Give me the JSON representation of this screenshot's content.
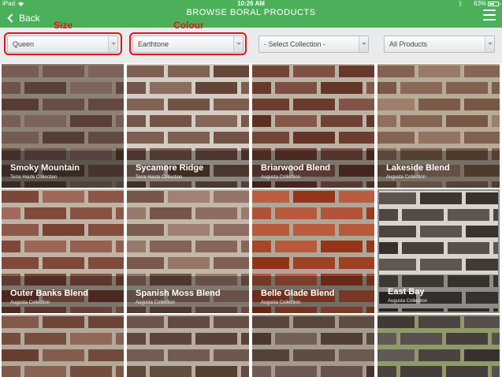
{
  "status_bar": {
    "carrier": "iPad",
    "time": "10:26 AM",
    "battery_percent": "63%",
    "battery_level": 0.63
  },
  "nav": {
    "back_label": "Back",
    "title": "BROWSE BORAL PRODUCTS"
  },
  "filters": {
    "size": "Queen",
    "colour": "Earthtone",
    "collection": "- Select Collection -",
    "products": "All Products"
  },
  "annotations": {
    "size": "Size",
    "colour": "Colour"
  },
  "products": [
    {
      "name": "Smoky Mountain",
      "collection": "Terre Haute Collection",
      "brick": "#6b5248",
      "mortar": "#8d8174"
    },
    {
      "name": "Sycamore Ridge",
      "collection": "Terre Haute Collection",
      "brick": "#7a5a4c",
      "mortar": "#d3cdc3"
    },
    {
      "name": "Briarwood Blend",
      "collection": "Augusta Collection",
      "brick": "#74463a",
      "mortar": "#bcb2a4"
    },
    {
      "name": "Lakeside Blend",
      "collection": "Augusta Collection",
      "brick": "#8a6a58",
      "mortar": "#b7aa98"
    },
    {
      "name": "Outer Banks Blend",
      "collection": "Augusta Collection",
      "brick": "#8a5547",
      "mortar": "#bfb3a4"
    },
    {
      "name": "Spanish Moss Blend",
      "collection": "Augusta Collection",
      "brick": "#8a6a5c",
      "mortar": "#c2b7a8"
    },
    {
      "name": "Belle Glade Blend",
      "collection": "Augusta Collection",
      "brick": "#a84a2e",
      "mortar": "#b0a698"
    },
    {
      "name": "East Bay",
      "collection": "Augusta Collection",
      "brick": "#4e4540",
      "mortar": "#d8d4cc"
    },
    {
      "name": "",
      "collection": "",
      "brick": "#7a5244",
      "mortar": "#b3a899"
    },
    {
      "name": "",
      "collection": "",
      "brick": "#6a5448",
      "mortar": "#b8ad9f"
    },
    {
      "name": "",
      "collection": "",
      "brick": "#5c4a42",
      "mortar": "#a59a8c"
    },
    {
      "name": "",
      "collection": "",
      "brick": "#4c4440",
      "mortar": "#8f9a6a"
    }
  ]
}
